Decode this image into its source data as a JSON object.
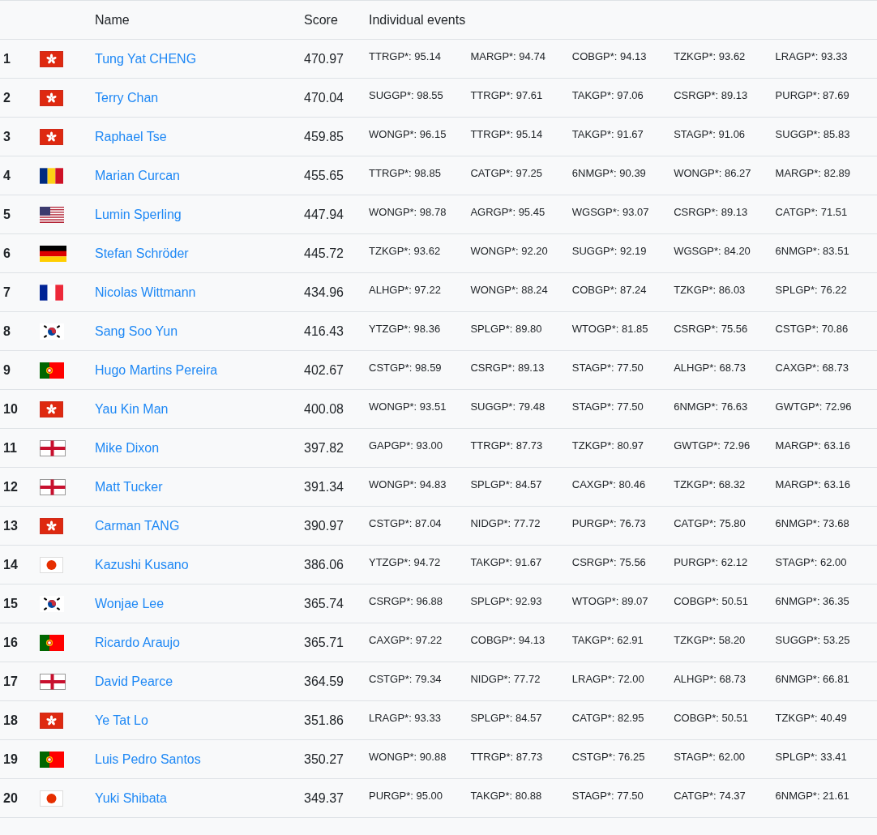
{
  "table": {
    "columns": [
      "Name",
      "Score",
      "Individual events"
    ],
    "rows": [
      {
        "rank": "1",
        "kind": "hk",
        "name": "Tung Yat CHENG",
        "score": "470.97",
        "events": [
          "TTRGP*: 95.14",
          "MARGP*: 94.74",
          "COBGP*: 94.13",
          "TZKGP*: 93.62",
          "LRAGP*: 93.33"
        ]
      },
      {
        "rank": "2",
        "kind": "hk",
        "name": "Terry Chan",
        "score": "470.04",
        "events": [
          "SUGGP*: 98.55",
          "TTRGP*: 97.61",
          "TAKGP*: 97.06",
          "CSRGP*: 89.13",
          "PURGP*: 87.69"
        ]
      },
      {
        "rank": "3",
        "kind": "hk",
        "name": "Raphael Tse",
        "score": "459.85",
        "events": [
          "WONGP*: 96.15",
          "TTRGP*: 95.14",
          "TAKGP*: 91.67",
          "STAGP*: 91.06",
          "SUGGP*: 85.83"
        ]
      },
      {
        "rank": "4",
        "kind": "ro",
        "name": "Marian Curcan",
        "score": "455.65",
        "events": [
          "TTRGP*: 98.85",
          "CATGP*: 97.25",
          "6NMGP*: 90.39",
          "WONGP*: 86.27",
          "MARGP*: 82.89"
        ]
      },
      {
        "rank": "5",
        "kind": "us",
        "name": "Lumin Sperling",
        "score": "447.94",
        "events": [
          "WONGP*: 98.78",
          "AGRGP*: 95.45",
          "WGSGP*: 93.07",
          "CSRGP*: 89.13",
          "CATGP*: 71.51"
        ]
      },
      {
        "rank": "6",
        "kind": "de",
        "name": "Stefan Schröder",
        "score": "445.72",
        "events": [
          "TZKGP*: 93.62",
          "WONGP*: 92.20",
          "SUGGP*: 92.19",
          "WGSGP*: 84.20",
          "6NMGP*: 83.51"
        ]
      },
      {
        "rank": "7",
        "kind": "fr",
        "name": "Nicolas Wittmann",
        "score": "434.96",
        "events": [
          "ALHGP*: 97.22",
          "WONGP*: 88.24",
          "COBGP*: 87.24",
          "TZKGP*: 86.03",
          "SPLGP*: 76.22"
        ]
      },
      {
        "rank": "8",
        "kind": "kr",
        "name": "Sang Soo Yun",
        "score": "416.43",
        "events": [
          "YTZGP*: 98.36",
          "SPLGP*: 89.80",
          "WTOGP*: 81.85",
          "CSRGP*: 75.56",
          "CSTGP*: 70.86"
        ]
      },
      {
        "rank": "9",
        "kind": "pt",
        "name": "Hugo Martins Pereira",
        "score": "402.67",
        "events": [
          "CSTGP*: 98.59",
          "CSRGP*: 89.13",
          "STAGP*: 77.50",
          "ALHGP*: 68.73",
          "CAXGP*: 68.73"
        ]
      },
      {
        "rank": "10",
        "kind": "hk",
        "name": "Yau Kin Man",
        "score": "400.08",
        "events": [
          "WONGP*: 93.51",
          "SUGGP*: 79.48",
          "STAGP*: 77.50",
          "6NMGP*: 76.63",
          "GWTGP*: 72.96"
        ]
      },
      {
        "rank": "11",
        "kind": "en",
        "name": "Mike Dixon",
        "score": "397.82",
        "events": [
          "GAPGP*: 93.00",
          "TTRGP*: 87.73",
          "TZKGP*: 80.97",
          "GWTGP*: 72.96",
          "MARGP*: 63.16"
        ]
      },
      {
        "rank": "12",
        "kind": "en",
        "name": "Matt Tucker",
        "score": "391.34",
        "events": [
          "WONGP*: 94.83",
          "SPLGP*: 84.57",
          "CAXGP*: 80.46",
          "TZKGP*: 68.32",
          "MARGP*: 63.16"
        ]
      },
      {
        "rank": "13",
        "kind": "hk",
        "name": "Carman TANG",
        "score": "390.97",
        "events": [
          "CSTGP*: 87.04",
          "NIDGP*: 77.72",
          "PURGP*: 76.73",
          "CATGP*: 75.80",
          "6NMGP*: 73.68"
        ]
      },
      {
        "rank": "14",
        "kind": "jp",
        "name": "Kazushi Kusano",
        "score": "386.06",
        "events": [
          "YTZGP*: 94.72",
          "TAKGP*: 91.67",
          "CSRGP*: 75.56",
          "PURGP*: 62.12",
          "STAGP*: 62.00"
        ]
      },
      {
        "rank": "15",
        "kind": "kr",
        "name": "Wonjae Lee",
        "score": "365.74",
        "events": [
          "CSRGP*: 96.88",
          "SPLGP*: 92.93",
          "WTOGP*: 89.07",
          "COBGP*: 50.51",
          "6NMGP*: 36.35"
        ]
      },
      {
        "rank": "16",
        "kind": "pt",
        "name": "Ricardo Araujo",
        "score": "365.71",
        "events": [
          "CAXGP*: 97.22",
          "COBGP*: 94.13",
          "TAKGP*: 62.91",
          "TZKGP*: 58.20",
          "SUGGP*: 53.25"
        ]
      },
      {
        "rank": "17",
        "kind": "en",
        "name": "David Pearce",
        "score": "364.59",
        "events": [
          "CSTGP*: 79.34",
          "NIDGP*: 77.72",
          "LRAGP*: 72.00",
          "ALHGP*: 68.73",
          "6NMGP*: 66.81"
        ]
      },
      {
        "rank": "18",
        "kind": "hk",
        "name": "Ye Tat Lo",
        "score": "351.86",
        "events": [
          "LRAGP*: 93.33",
          "SPLGP*: 84.57",
          "CATGP*: 82.95",
          "COBGP*: 50.51",
          "TZKGP*: 40.49"
        ]
      },
      {
        "rank": "19",
        "kind": "pt",
        "name": "Luis Pedro Santos",
        "score": "350.27",
        "events": [
          "WONGP*: 90.88",
          "TTRGP*: 87.73",
          "CSTGP*: 76.25",
          "STAGP*: 62.00",
          "SPLGP*: 33.41"
        ]
      },
      {
        "rank": "20",
        "kind": "jp",
        "name": "Yuki Shibata",
        "score": "349.37",
        "events": [
          "PURGP*: 95.00",
          "TAKGP*: 80.88",
          "STAGP*: 77.50",
          "CATGP*: 74.37",
          "6NMGP*: 21.61"
        ]
      }
    ]
  }
}
